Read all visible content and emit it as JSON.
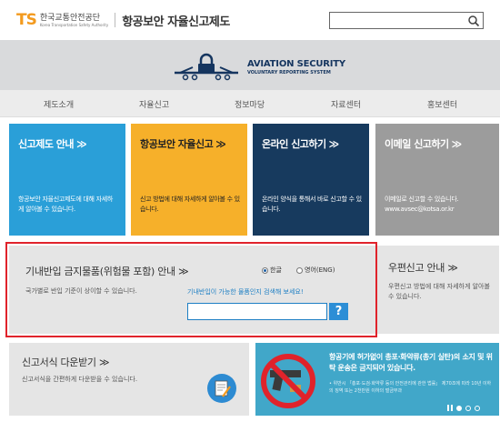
{
  "header": {
    "logo_ts": "TS",
    "org_name": "한국교통안전공단",
    "org_sub": "Korea Transportation Safety Authority",
    "site_title": "항공보안 자율신고제도",
    "search_placeholder": ""
  },
  "banner": {
    "line1": "AVIATION SECURITY",
    "line2": "VOLUNTARY REPORTING SYSTEM"
  },
  "nav": [
    "제도소개",
    "자율신고",
    "정보마당",
    "자료센터",
    "홍보센터"
  ],
  "tiles": [
    {
      "title": "신고제도 안내",
      "arrow": "≫",
      "desc": "항공보안 자율신고제도에 대해 자세하게 알아볼 수 있습니다.",
      "bg": "#2a9fd8"
    },
    {
      "title": "항공보안 자율신고",
      "arrow": "≫",
      "desc": "신고 방법에 대해 자세하게 알아볼 수 있습니다.",
      "bg": "#f6b02a"
    },
    {
      "title": "온라인 신고하기",
      "arrow": "≫",
      "desc": "온라인 양식을 통해서 바로 신고할 수 있습니다.",
      "bg": "#173a5e"
    },
    {
      "title": "이메일 신고하기",
      "arrow": "≫",
      "desc": "이메일로 신고할 수 있습니다. www.avsec@kotsa.or.kr",
      "bg": "#9c9c9c"
    }
  ],
  "prohibited": {
    "title": "기내반입 금지물품(위험물 포함) 안내",
    "arrow": "≫",
    "desc": "국가별로 반입 기준이 상이할 수 있습니다.",
    "lang_ko": "한글",
    "lang_en": "영어(ENG)",
    "search_link": "기내반입이 가능한 물품인지 검색해 보세요!",
    "search_value": "",
    "search_btn": "?"
  },
  "postal": {
    "title": "우편신고 안내",
    "arrow": "≫",
    "desc": "우편신고 방법에 대해 자세하게 알아볼 수 있습니다."
  },
  "forms": {
    "title": "신고서식 다운받기",
    "arrow": "≫",
    "desc": "신고서식을 간편하게 다운받을 수 있습니다."
  },
  "notice": {
    "title": "항공기에 허가없이 총포·화약류(총기 실탄)의 소지 및 위탁 운송은 금지되어 있습니다.",
    "desc": "• 위반시 「총포·도검·화약류 등의 안전관리에 관한 법률」 제70조에 따라 10년 이하의 징역 또는 2천만원 이하의 벌금부과"
  },
  "colors": {
    "brand_blue": "#1d7fc4",
    "highlight_red": "#e0232b"
  }
}
